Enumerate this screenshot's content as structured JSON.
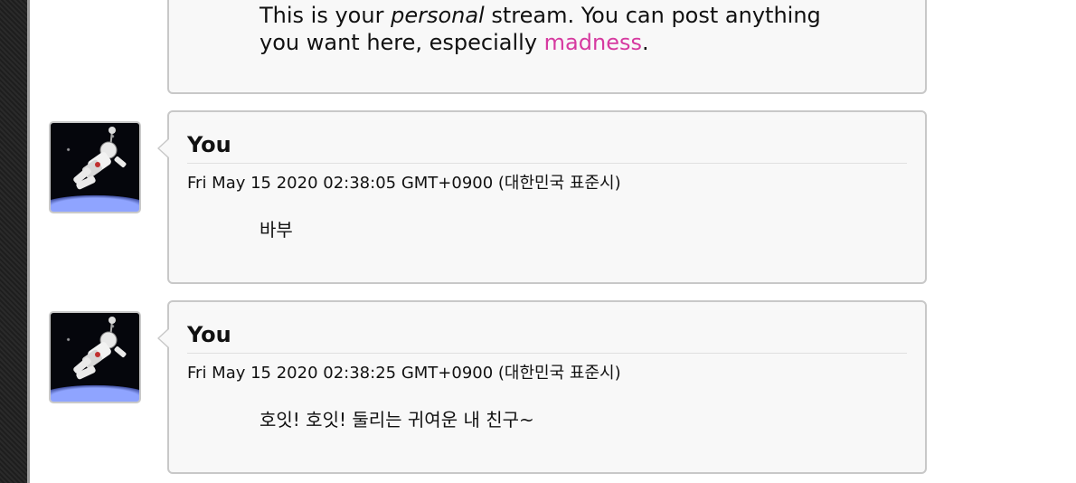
{
  "intro": {
    "text_before": "This is your ",
    "emphasis": "personal",
    "text_middle": " stream. You can post anything you want here, especially ",
    "link": "madness",
    "text_after": "."
  },
  "posts": [
    {
      "author": "You",
      "timestamp": "Fri May 15 2020 02:38:05 GMT+0900 (대한민국 표준시)",
      "message": "바부"
    },
    {
      "author": "You",
      "timestamp": "Fri May 15 2020 02:38:25 GMT+0900 (대한민국 표준시)",
      "message": "호잇! 호잇! 둘리는 귀여운 내 친구~"
    }
  ],
  "colors": {
    "accent": "#d63aa0",
    "bubble_bg": "#f8f8f8",
    "bubble_border": "#c8c8c8"
  },
  "icons": {
    "avatar": "astronaut-avatar"
  }
}
